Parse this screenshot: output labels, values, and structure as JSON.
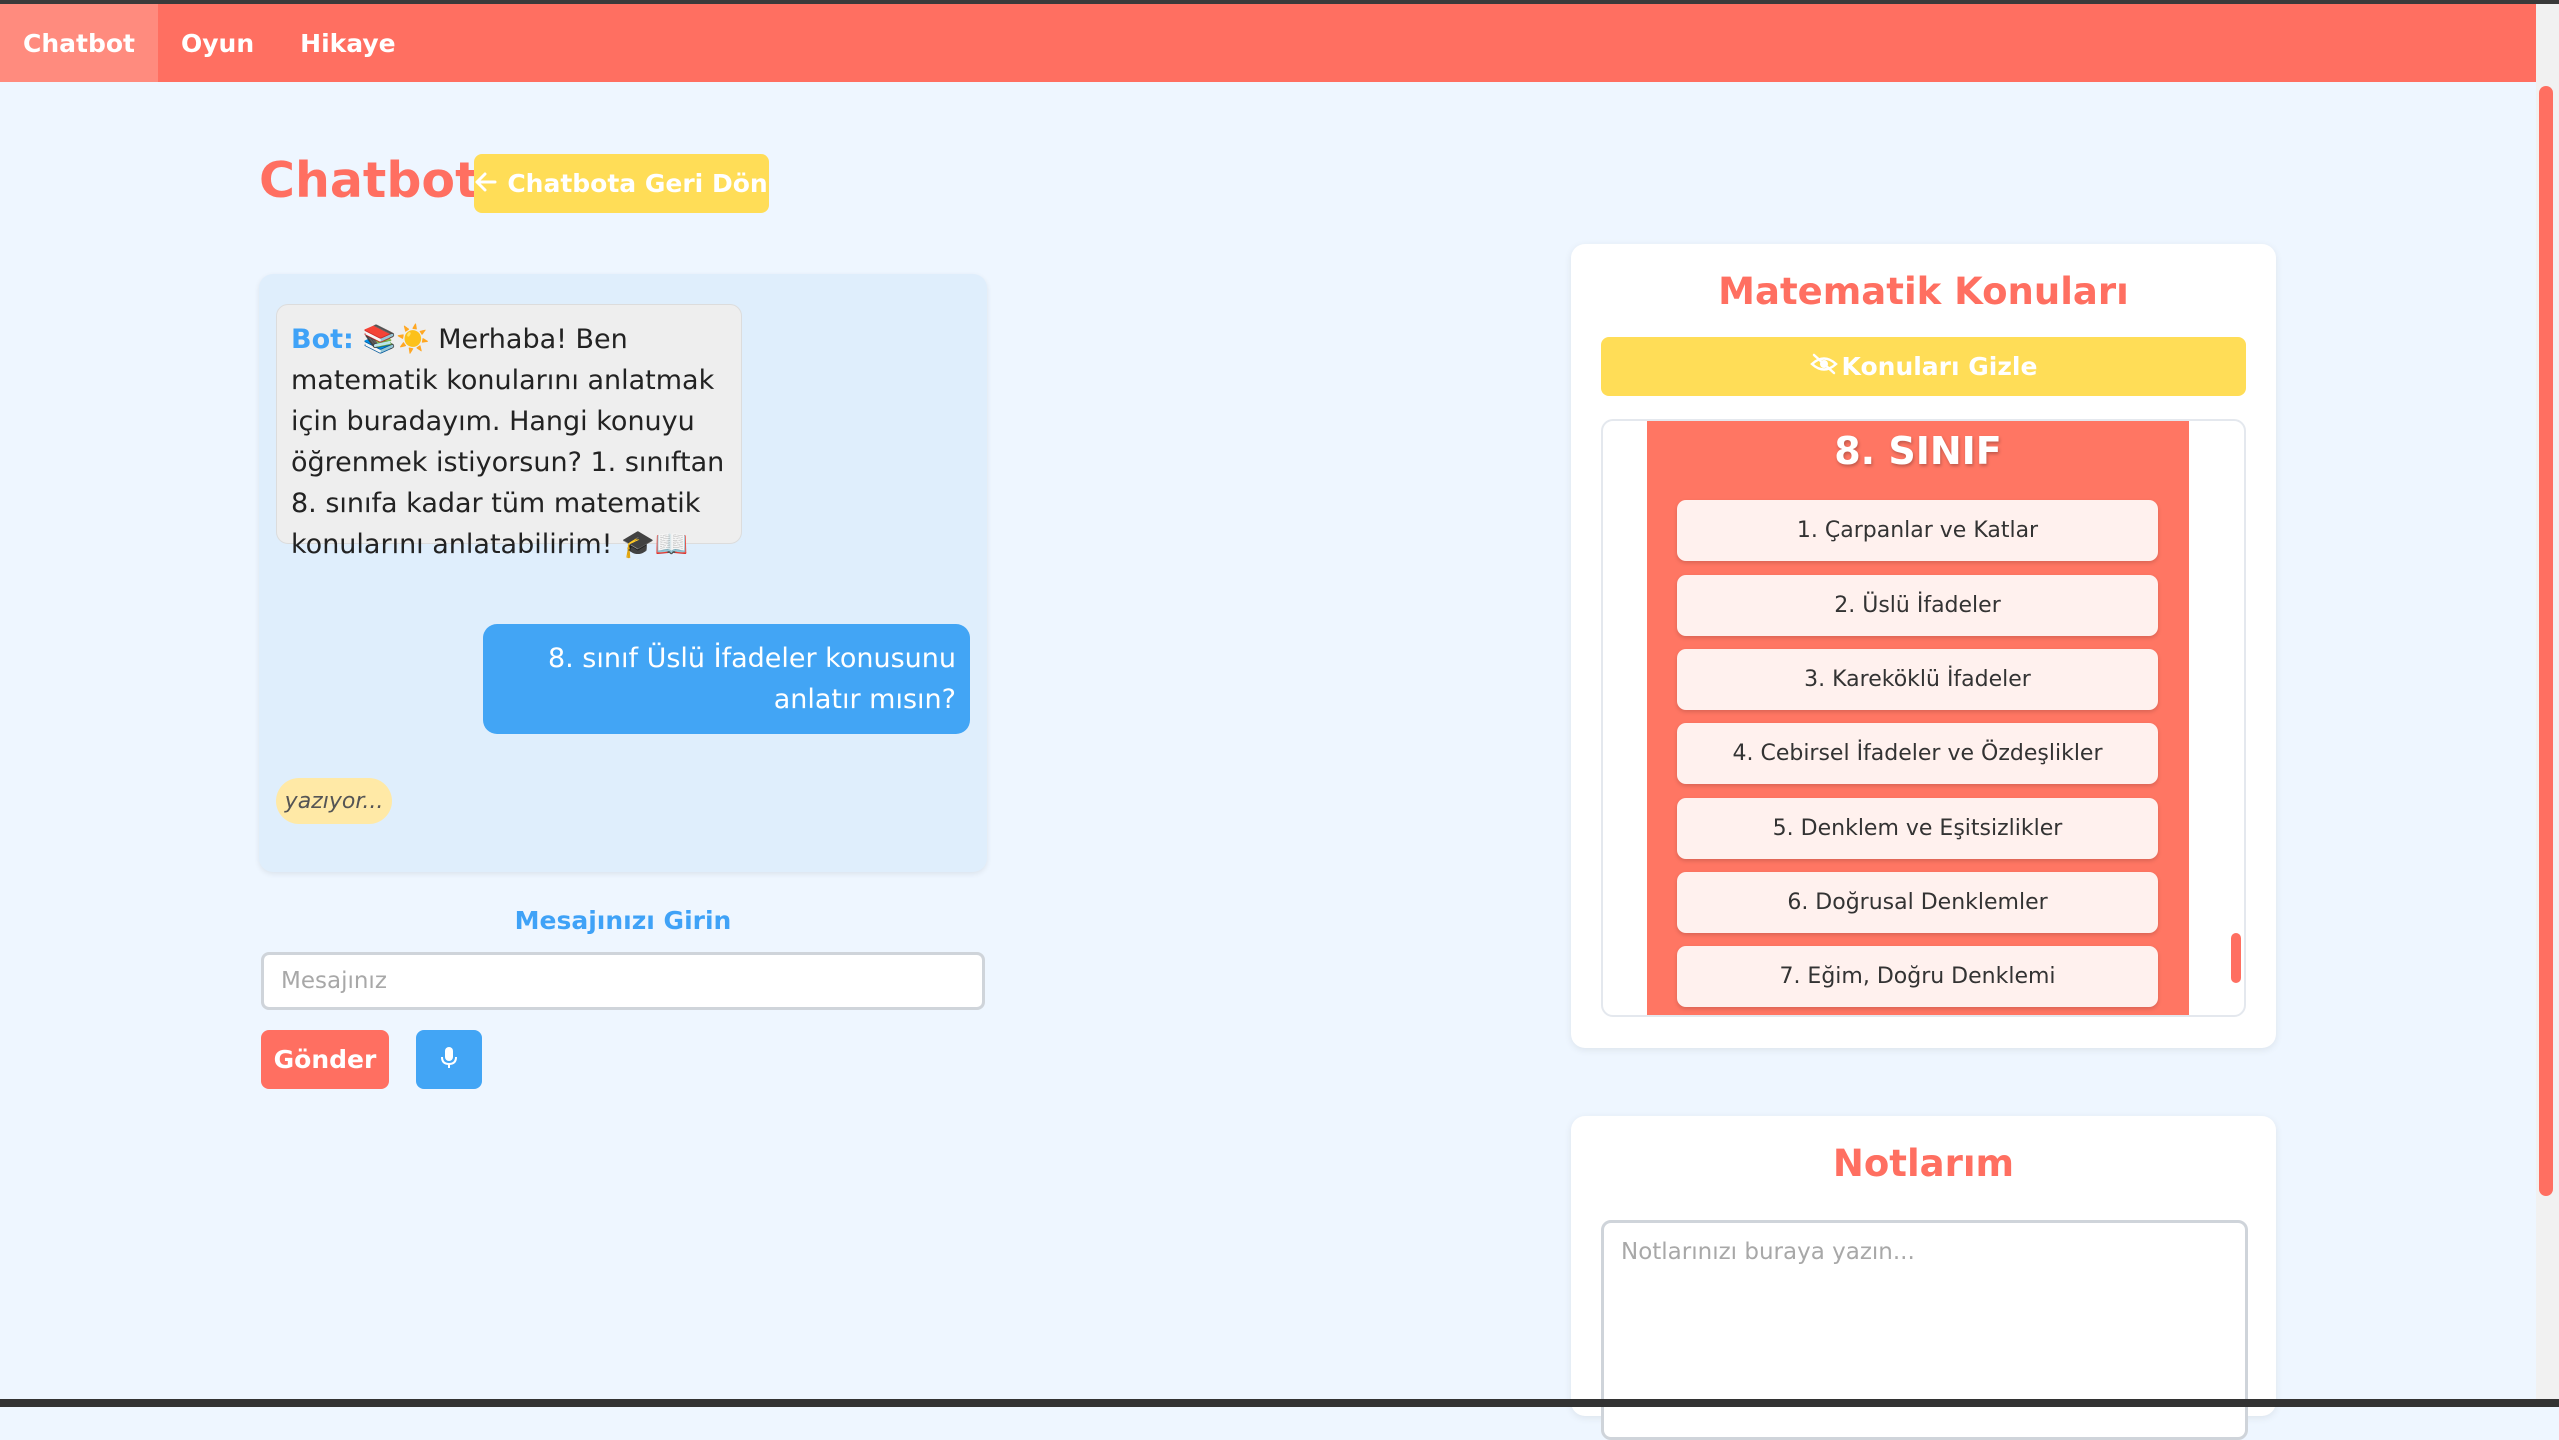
{
  "nav": {
    "items": [
      {
        "label": "Chatbot",
        "active": true
      },
      {
        "label": "Oyun",
        "active": false
      },
      {
        "label": "Hikaye",
        "active": false
      }
    ]
  },
  "page": {
    "title": "Chatbot",
    "back_button_label": "Chatbota Geri Dön"
  },
  "chat": {
    "bot_label": "Bot:",
    "bot_message": "📚☀️ Merhaba! Ben matematik konularını anlatmak için buradayım. Hangi konuyu öğrenmek istiyorsun? 1. sınıftan 8. sınıfa kadar tüm matematik konularını anlatabilirim! 🎓📖",
    "user_message": "8. sınıf Üslü İfadeler konusunu anlatır mısın?",
    "typing_indicator": "yazıyor..."
  },
  "input": {
    "label": "Mesajınızı Girin",
    "value": "",
    "placeholder": "Mesajınız",
    "send_label": "Gönder",
    "mic_icon": "microphone-icon"
  },
  "topics": {
    "title": "Matematik Konuları",
    "hide_button_label": "Konuları Gizle",
    "hide_icon": "eye-slash-icon",
    "grade_title": "8. SINIF",
    "items": [
      "1. Çarpanlar ve Katlar",
      "2. Üslü İfadeler",
      "3. Kareköklü İfadeler",
      "4. Cebirsel İfadeler ve Özdeşlikler",
      "5. Denklem ve Eşitsizlikler",
      "6. Doğrusal Denklemler",
      "7. Eğim, Doğru Denklemi"
    ]
  },
  "notes": {
    "title": "Notlarım",
    "value": "",
    "placeholder": "Notlarınızı buraya yazın..."
  },
  "colors": {
    "primary": "#ff6f61",
    "accent_yellow": "#ffdd57",
    "accent_blue": "#42a5f5",
    "background": "#eef6ff"
  }
}
